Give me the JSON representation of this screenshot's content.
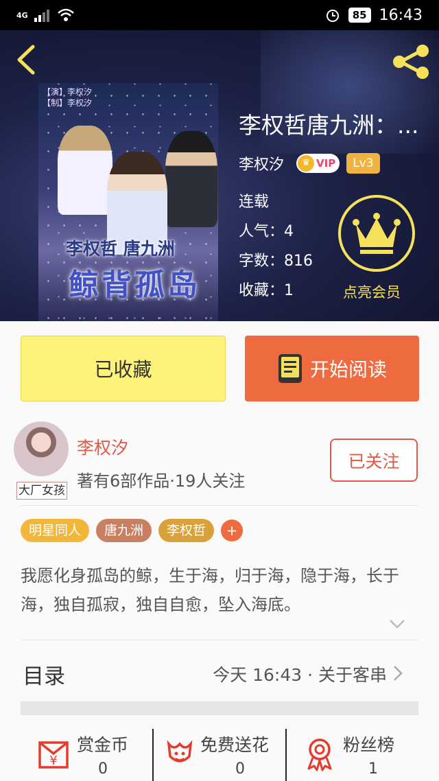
{
  "status_bar": {
    "network": "4G",
    "battery": "85",
    "time": "16:43"
  },
  "book": {
    "title": "李权哲唐九洲：...",
    "author": "李权汐",
    "vip_label": "VIP",
    "level": "Lv3",
    "status": "连载",
    "popularity": "人气：4",
    "word_count": "字数：816",
    "favorites": "收藏：1",
    "member_label": "点亮会员",
    "cover": {
      "line1": "【演】李权汐",
      "line2": "【制】李权汐",
      "subtitle": "李权哲 唐九洲",
      "title": "鲸背孤岛"
    }
  },
  "actions": {
    "collected_label": "已收藏",
    "read_label": "开始阅读"
  },
  "author_card": {
    "name": "李权汐",
    "stats": "著有6部作品·19人关注",
    "avatar_tag": "大厂女孩",
    "follow_label": "已关注"
  },
  "tags": [
    "明星同人",
    "唐九洲",
    "李权哲"
  ],
  "tag_add": "+",
  "description": "我愿化身孤岛的鲸，生于海，归于海，隐于海，长于海，独自孤寂，独自自愈，坠入海底。",
  "toc": {
    "label": "目录",
    "update": "今天 16:43 · 关于客串"
  },
  "bottom_stats": [
    {
      "label": "赏金币",
      "value": "0",
      "icon": "gift-coin-icon"
    },
    {
      "label": "免费送花",
      "value": "0",
      "icon": "flower-icon"
    },
    {
      "label": "粉丝榜",
      "value": "1",
      "icon": "medal-icon"
    }
  ],
  "colors": {
    "accent": "#ee6a3f",
    "collected": "#fdf27a",
    "member": "#f6e15a",
    "author": "#e05848"
  }
}
